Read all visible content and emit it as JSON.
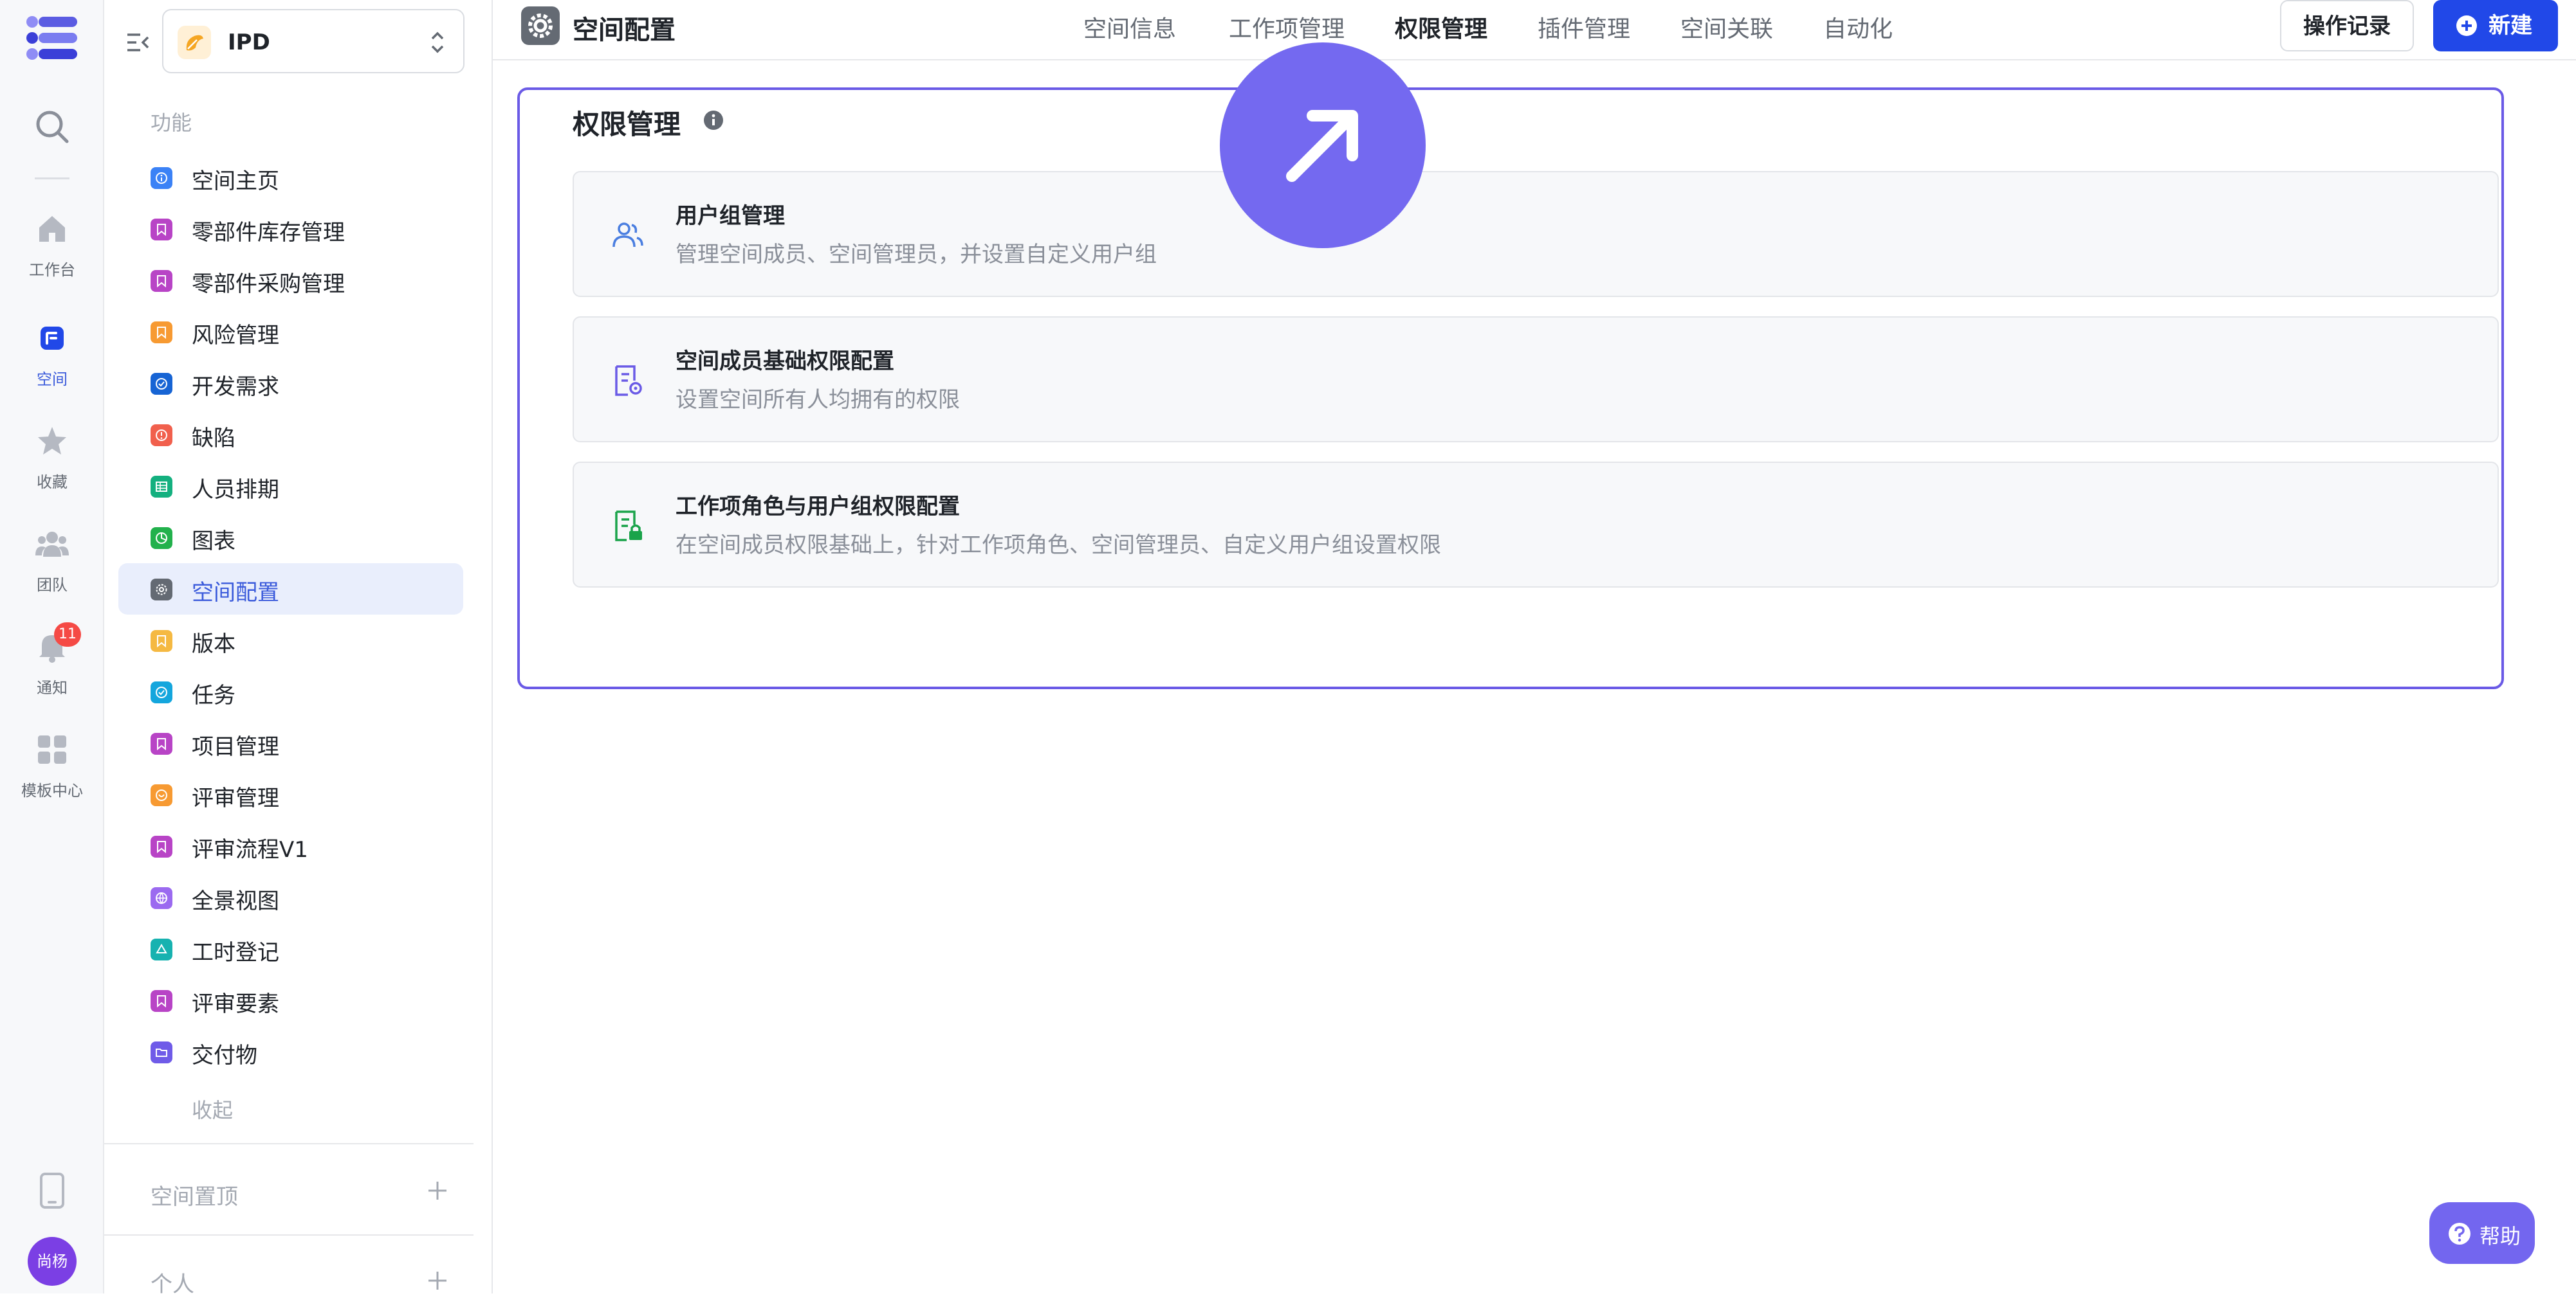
{
  "rail": {
    "items": [
      {
        "label": "工作台"
      },
      {
        "label": "空间"
      },
      {
        "label": "收藏"
      },
      {
        "label": "团队"
      },
      {
        "label": "通知",
        "badge": "11"
      },
      {
        "label": "模板中心"
      }
    ],
    "avatar": "尚杨"
  },
  "sidebar": {
    "space_name": "IPD",
    "section_label": "功能",
    "items": [
      {
        "label": "空间主页",
        "color": "#3b82f6",
        "icon": "info-icon"
      },
      {
        "label": "零部件库存管理",
        "color": "#b844c6",
        "icon": "bookmark-icon"
      },
      {
        "label": "零部件采购管理",
        "color": "#b844c6",
        "icon": "bookmark-icon"
      },
      {
        "label": "风险管理",
        "color": "#f79a32",
        "icon": "bookmark-icon"
      },
      {
        "label": "开发需求",
        "color": "#1764d4",
        "icon": "check-circle-icon"
      },
      {
        "label": "缺陷",
        "color": "#f1604d",
        "icon": "alert-icon"
      },
      {
        "label": "人员排期",
        "color": "#14b07f",
        "icon": "table-icon"
      },
      {
        "label": "图表",
        "color": "#22b14c",
        "icon": "pie-chart-icon"
      },
      {
        "label": "空间配置",
        "color": "#646a73",
        "icon": "gear-icon"
      },
      {
        "label": "版本",
        "color": "#f5b942",
        "icon": "bookmark-icon"
      },
      {
        "label": "任务",
        "color": "#14a6dd",
        "icon": "check-circle-icon"
      },
      {
        "label": "项目管理",
        "color": "#b844c6",
        "icon": "bookmark-icon"
      },
      {
        "label": "评审管理",
        "color": "#f79a32",
        "icon": "review-icon"
      },
      {
        "label": "评审流程V1",
        "color": "#b844c6",
        "icon": "bookmark-icon"
      },
      {
        "label": "全景视图",
        "color": "#9b6af0",
        "icon": "panorama-icon"
      },
      {
        "label": "工时登记",
        "color": "#17b2b0",
        "icon": "recycle-icon"
      },
      {
        "label": "评审要素",
        "color": "#b844c6",
        "icon": "bookmark-icon"
      },
      {
        "label": "交付物",
        "color": "#6f5be8",
        "icon": "folder-icon"
      }
    ],
    "collapse_label": "收起",
    "pinned_label": "空间置顶",
    "personal_label": "个人"
  },
  "header": {
    "title": "空间配置",
    "tabs": [
      {
        "label": "空间信息"
      },
      {
        "label": "工作项管理"
      },
      {
        "label": "权限管理",
        "active": true
      },
      {
        "label": "插件管理"
      },
      {
        "label": "空间关联"
      },
      {
        "label": "自动化"
      }
    ],
    "log_button": "操作记录",
    "new_button": "新建"
  },
  "main": {
    "title": "权限管理",
    "cards": [
      {
        "title": "用户组管理",
        "desc": "管理空间成员、空间管理员，并设置自定义用户组",
        "icon": "users-icon"
      },
      {
        "title": "空间成员基础权限配置",
        "desc": "设置空间所有人均拥有的权限",
        "icon": "doc-settings-icon"
      },
      {
        "title": "工作项角色与用户组权限配置",
        "desc": "在空间成员权限基础上，针对工作项角色、空间管理员、自定义用户组设置权限",
        "icon": "doc-lock-icon"
      }
    ]
  },
  "help": {
    "label": "帮助"
  },
  "colors": {
    "accent": "#2148e8",
    "highlight": "#6a5ae6",
    "active_nav_bg": "#e9eefc"
  }
}
